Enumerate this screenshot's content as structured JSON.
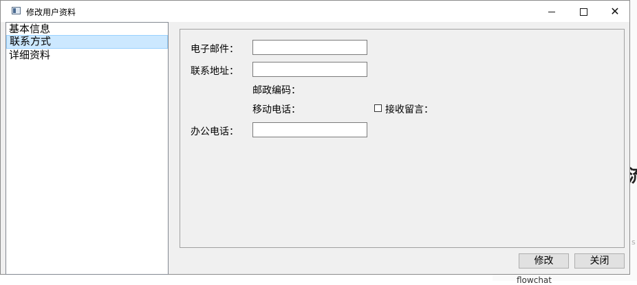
{
  "window": {
    "title": "修改用户资料",
    "controls": {
      "minimize_icon": "minimize-icon",
      "maximize_icon": "maximize-icon",
      "close_icon": "close-icon",
      "close_glyph": "✕"
    }
  },
  "nav": {
    "items": [
      {
        "label": "基本信息",
        "selected": false
      },
      {
        "label": "联系方式",
        "selected": true
      },
      {
        "label": "详细资料",
        "selected": false
      }
    ]
  },
  "form": {
    "email_label": "电子邮件：",
    "email_value": "",
    "address_label": "联系地址：",
    "address_value": "",
    "zip_label": "邮政编码：",
    "mobile_label": "移动电话：",
    "receive_msg_label": "接收留言：",
    "receive_msg_checked": false,
    "office_phone_label": "办公电话：",
    "office_phone_value": ""
  },
  "buttons": {
    "modify": "修改",
    "close": "关闭"
  },
  "background": {
    "glyph": "流",
    "text": "flowchat",
    "edge_letter": "s"
  }
}
